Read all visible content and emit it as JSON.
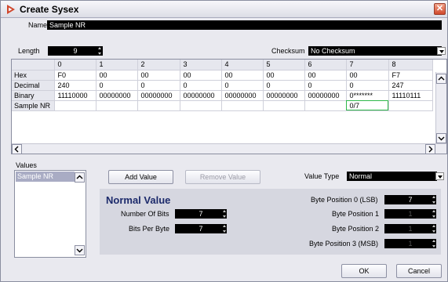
{
  "window": {
    "title": "Create Sysex"
  },
  "name_field": {
    "label": "Name",
    "value": "Sample NR"
  },
  "length_field": {
    "label": "Length",
    "value": "9"
  },
  "checksum": {
    "label": "Checksum",
    "value": "No Checksum"
  },
  "grid": {
    "columns": [
      "0",
      "1",
      "2",
      "3",
      "4",
      "5",
      "6",
      "7",
      "8"
    ],
    "rows": [
      {
        "label": "Hex",
        "cells": [
          "F0",
          "00",
          "00",
          "00",
          "00",
          "00",
          "00",
          "00",
          "F7"
        ]
      },
      {
        "label": "Decimal",
        "cells": [
          "240",
          "0",
          "0",
          "0",
          "0",
          "0",
          "0",
          "0",
          "247"
        ]
      },
      {
        "label": "Binary",
        "cells": [
          "11110000",
          "00000000",
          "00000000",
          "00000000",
          "00000000",
          "00000000",
          "00000000",
          "0*******",
          "11110111"
        ]
      },
      {
        "label": "Sample NR",
        "cells": [
          "",
          "",
          "",
          "",
          "",
          "",
          "",
          "0/7",
          ""
        ]
      }
    ]
  },
  "values": {
    "label": "Values",
    "items": [
      "Sample NR"
    ]
  },
  "buttons": {
    "add_value": "Add Value",
    "remove_value": "Remove Value",
    "ok": "OK",
    "cancel": "Cancel"
  },
  "value_type": {
    "label": "Value Type",
    "value": "Normal"
  },
  "normal_value": {
    "title": "Normal Value",
    "number_of_bits": {
      "label": "Number Of Bits",
      "value": "7"
    },
    "bits_per_byte": {
      "label": "Bits Per Byte",
      "value": "7"
    },
    "byte_positions": [
      {
        "label": "Byte Position 0 (LSB)",
        "value": "7",
        "enabled": true
      },
      {
        "label": "Byte Position 1",
        "value": "1",
        "enabled": false
      },
      {
        "label": "Byte Position 2",
        "value": "1",
        "enabled": false
      },
      {
        "label": "Byte Position 3 (MSB)",
        "value": "1",
        "enabled": false
      }
    ]
  },
  "colors": {
    "accent": "#1c2a6b",
    "selection_outline": "#2fb84a",
    "field_bg": "#000000",
    "close_button": "#d0472a"
  }
}
